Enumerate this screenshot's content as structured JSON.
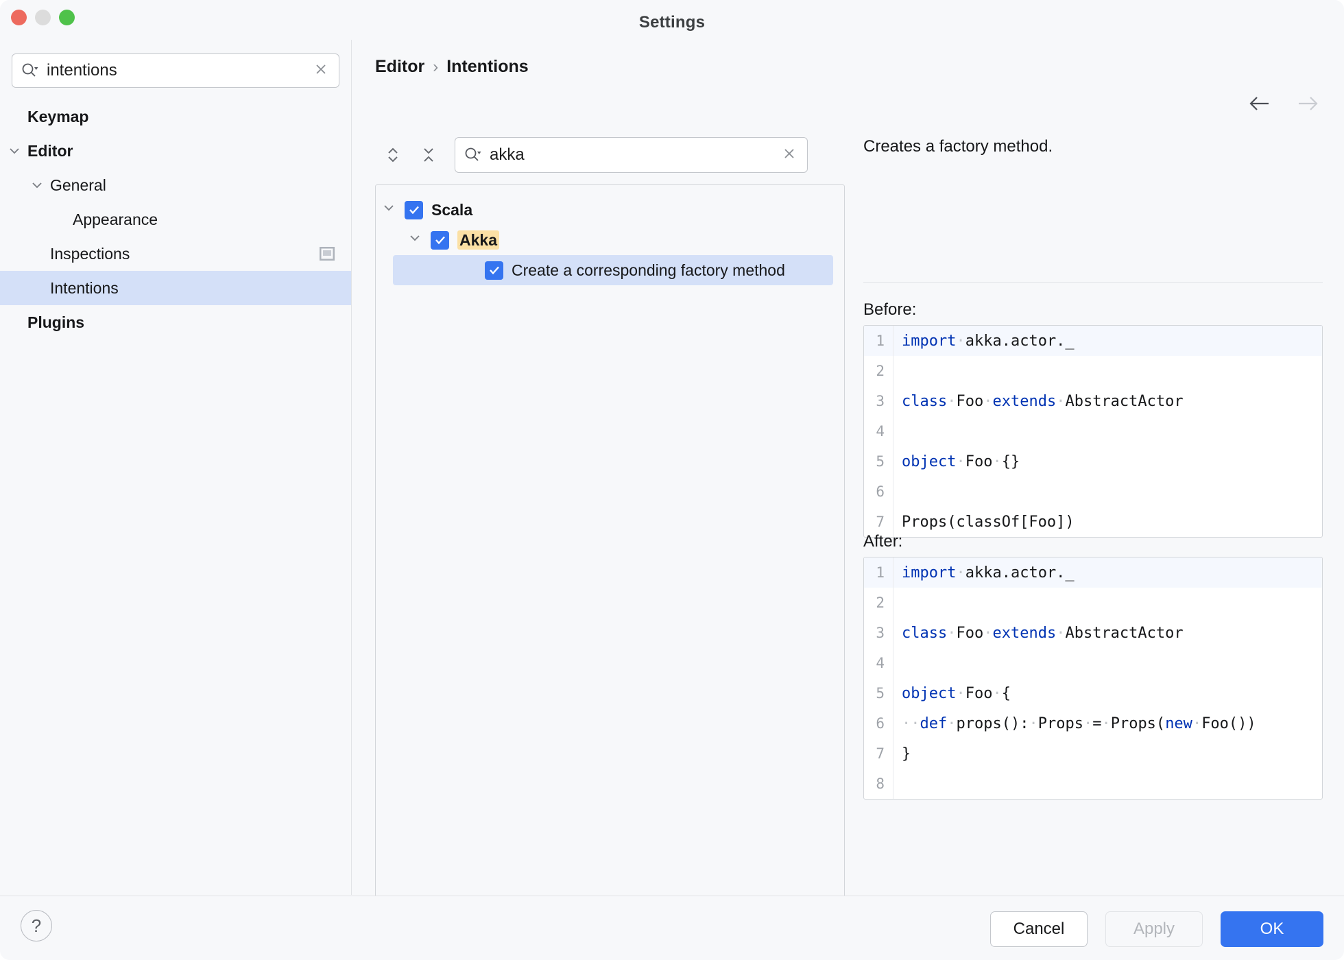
{
  "window": {
    "title": "Settings",
    "traffic_lights": [
      "close-button",
      "minimize-button",
      "zoom-button"
    ]
  },
  "sidebar": {
    "search": {
      "value": "intentions",
      "placeholder": "",
      "icon": "search-icon",
      "clear_icon": "clear-icon"
    },
    "items": [
      {
        "label": "Keymap",
        "indent": 0,
        "bold": true,
        "chevron": "",
        "selected": false,
        "badge": ""
      },
      {
        "label": "Editor",
        "indent": 0,
        "bold": true,
        "chevron": "down",
        "selected": false,
        "badge": ""
      },
      {
        "label": "General",
        "indent": 1,
        "bold": false,
        "chevron": "down",
        "selected": false,
        "badge": ""
      },
      {
        "label": "Appearance",
        "indent": 2,
        "bold": false,
        "chevron": "",
        "selected": false,
        "badge": ""
      },
      {
        "label": "Inspections",
        "indent": 1,
        "bold": false,
        "chevron": "",
        "selected": false,
        "badge": "open-in-window-icon"
      },
      {
        "label": "Intentions",
        "indent": 1,
        "bold": false,
        "chevron": "",
        "selected": true,
        "badge": ""
      },
      {
        "label": "Plugins",
        "indent": 0,
        "bold": true,
        "chevron": "",
        "selected": false,
        "badge": ""
      }
    ]
  },
  "header": {
    "breadcrumb": {
      "parent": "Editor",
      "separator": "›",
      "current": "Intentions"
    },
    "nav": {
      "back": "back-arrow-icon",
      "forward": "forward-arrow-icon",
      "back_enabled": true,
      "forward_enabled": false
    }
  },
  "intentions": {
    "toolbar": {
      "expand_all": "expand-all-icon",
      "collapse_all": "collapse-all-icon",
      "search": {
        "value": "akka",
        "placeholder": "",
        "icon": "search-icon",
        "clear_icon": "clear-icon"
      }
    },
    "tree": [
      {
        "label": "Scala",
        "indent": 0,
        "chevron": "down",
        "checked": true,
        "bold": true,
        "selected": false,
        "highlight": ""
      },
      {
        "label": "Akka",
        "indent": 1,
        "chevron": "down",
        "checked": true,
        "bold": true,
        "selected": false,
        "highlight": "Akka"
      },
      {
        "label": "Create a corresponding factory method",
        "indent": 2,
        "chevron": "",
        "checked": true,
        "bold": false,
        "selected": true,
        "highlight": ""
      }
    ]
  },
  "preview": {
    "description": "Creates a factory method.",
    "before_label": "Before:",
    "after_label": "After:",
    "before_code": [
      {
        "n": "1",
        "caret": true,
        "tokens": [
          {
            "t": "import",
            "k": "kw"
          },
          {
            "t": "·",
            "k": "ws"
          },
          {
            "t": "akka.actor._",
            "k": ""
          }
        ]
      },
      {
        "n": "2",
        "caret": false,
        "tokens": []
      },
      {
        "n": "3",
        "caret": false,
        "tokens": [
          {
            "t": "class",
            "k": "kw"
          },
          {
            "t": "·",
            "k": "ws"
          },
          {
            "t": "Foo",
            "k": ""
          },
          {
            "t": "·",
            "k": "ws"
          },
          {
            "t": "extends",
            "k": "kw"
          },
          {
            "t": "·",
            "k": "ws"
          },
          {
            "t": "AbstractActor",
            "k": ""
          }
        ]
      },
      {
        "n": "4",
        "caret": false,
        "tokens": []
      },
      {
        "n": "5",
        "caret": false,
        "tokens": [
          {
            "t": "object",
            "k": "kw"
          },
          {
            "t": "·",
            "k": "ws"
          },
          {
            "t": "Foo",
            "k": ""
          },
          {
            "t": "·",
            "k": "ws"
          },
          {
            "t": "{}",
            "k": ""
          }
        ]
      },
      {
        "n": "6",
        "caret": false,
        "tokens": []
      },
      {
        "n": "7",
        "caret": false,
        "tokens": [
          {
            "t": "Props(classOf[Foo])",
            "k": ""
          }
        ]
      }
    ],
    "after_code": [
      {
        "n": "1",
        "caret": true,
        "tokens": [
          {
            "t": "import",
            "k": "kw"
          },
          {
            "t": "·",
            "k": "ws"
          },
          {
            "t": "akka.actor._",
            "k": ""
          }
        ]
      },
      {
        "n": "2",
        "caret": false,
        "tokens": []
      },
      {
        "n": "3",
        "caret": false,
        "tokens": [
          {
            "t": "class",
            "k": "kw"
          },
          {
            "t": "·",
            "k": "ws"
          },
          {
            "t": "Foo",
            "k": ""
          },
          {
            "t": "·",
            "k": "ws"
          },
          {
            "t": "extends",
            "k": "kw"
          },
          {
            "t": "·",
            "k": "ws"
          },
          {
            "t": "AbstractActor",
            "k": ""
          }
        ]
      },
      {
        "n": "4",
        "caret": false,
        "tokens": []
      },
      {
        "n": "5",
        "caret": false,
        "tokens": [
          {
            "t": "object",
            "k": "kw"
          },
          {
            "t": "·",
            "k": "ws"
          },
          {
            "t": "Foo",
            "k": ""
          },
          {
            "t": "·",
            "k": "ws"
          },
          {
            "t": "{",
            "k": ""
          }
        ]
      },
      {
        "n": "6",
        "caret": false,
        "tokens": [
          {
            "t": "··",
            "k": "ws"
          },
          {
            "t": "def",
            "k": "kw"
          },
          {
            "t": "·",
            "k": "ws"
          },
          {
            "t": "props():",
            "k": ""
          },
          {
            "t": "·",
            "k": "ws"
          },
          {
            "t": "Props",
            "k": ""
          },
          {
            "t": "·",
            "k": "ws"
          },
          {
            "t": "=",
            "k": ""
          },
          {
            "t": "·",
            "k": "ws"
          },
          {
            "t": "Props(",
            "k": ""
          },
          {
            "t": "new",
            "k": "kw"
          },
          {
            "t": "·",
            "k": "ws"
          },
          {
            "t": "Foo())",
            "k": ""
          }
        ]
      },
      {
        "n": "7",
        "caret": false,
        "tokens": [
          {
            "t": "}",
            "k": ""
          }
        ]
      },
      {
        "n": "8",
        "caret": false,
        "tokens": []
      }
    ]
  },
  "footer": {
    "help_icon": "help-icon",
    "help_label": "?",
    "buttons": [
      {
        "label": "Cancel",
        "style": "secondary"
      },
      {
        "label": "Apply",
        "style": "disabled"
      },
      {
        "label": "OK",
        "style": "primary"
      }
    ]
  },
  "colors": {
    "accent": "#3574f0",
    "selection": "#d4e0f8",
    "highlight": "#fbe0a5",
    "keyword": "#0033b3",
    "background": "#f7f8fa"
  }
}
